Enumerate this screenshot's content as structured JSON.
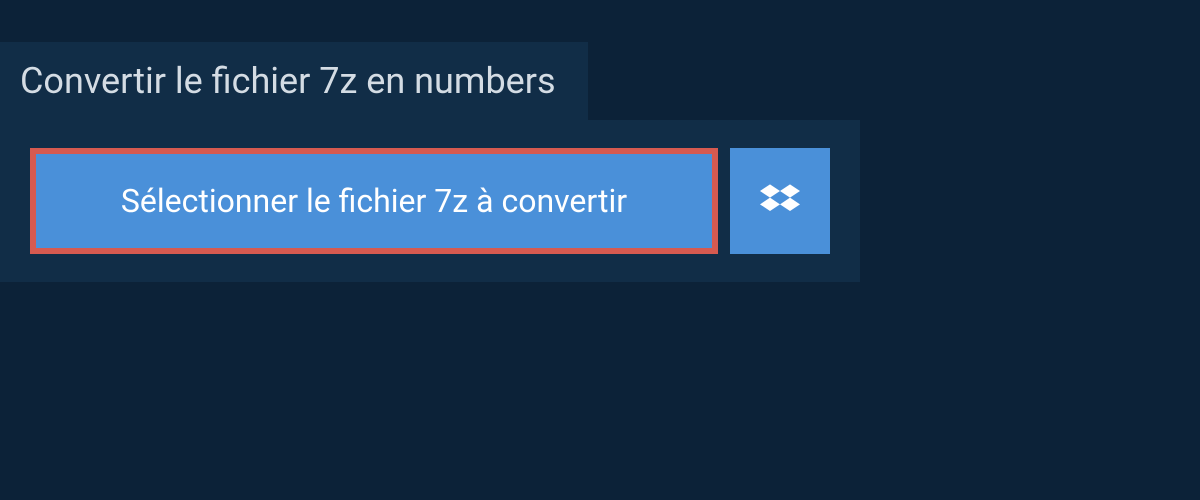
{
  "header": {
    "title": "Convertir le fichier 7z en numbers"
  },
  "upload": {
    "select_file_label": "Sélectionner le fichier 7z à convertir"
  }
}
